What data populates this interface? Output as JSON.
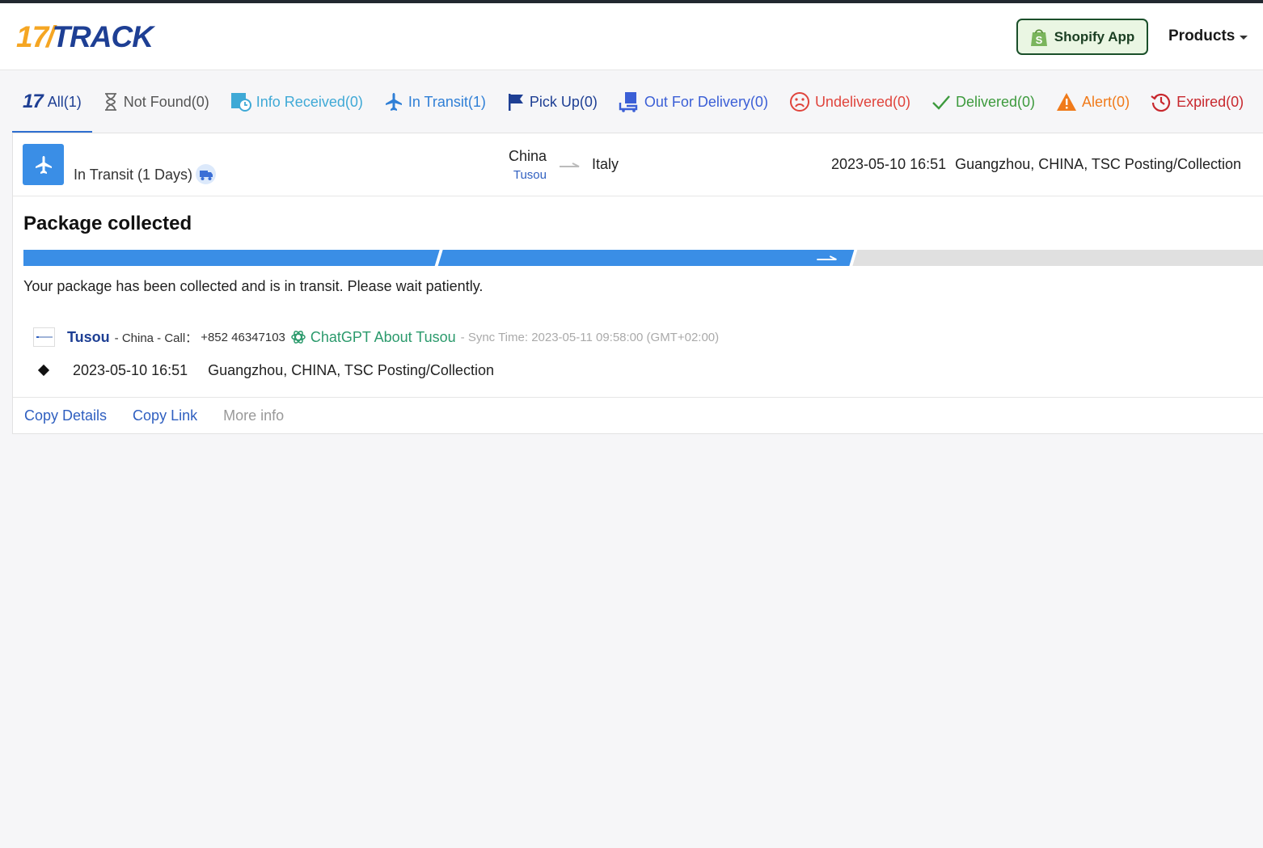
{
  "brand": {
    "logo_num": "17",
    "logo_word": "TRACK"
  },
  "header": {
    "shopify_label": "Shopify App",
    "products_label": "Products"
  },
  "colors": {
    "accent": "#3a8ee6",
    "brand_blue": "#1e3f94",
    "brand_orange": "#f5a623"
  },
  "tabs": [
    {
      "label": "All(1)",
      "icon": "seventeen-logo-icon",
      "color": "#1e3f94"
    },
    {
      "label": "Not Found(0)",
      "icon": "hourglass-icon",
      "color": "#555555"
    },
    {
      "label": "Info Received(0)",
      "icon": "info-received-icon",
      "color": "#3fa9d6"
    },
    {
      "label": "In Transit(1)",
      "icon": "plane-icon",
      "color": "#2f7fd6"
    },
    {
      "label": "Pick Up(0)",
      "icon": "flag-icon",
      "color": "#1e3f94"
    },
    {
      "label": "Out For Delivery(0)",
      "icon": "out-for-delivery-icon",
      "color": "#3b5fd6"
    },
    {
      "label": "Undelivered(0)",
      "icon": "sad-face-icon",
      "color": "#e0443c"
    },
    {
      "label": "Delivered(0)",
      "icon": "check-icon",
      "color": "#3d9a3d"
    },
    {
      "label": "Alert(0)",
      "icon": "warning-icon",
      "color": "#f07a1a"
    },
    {
      "label": "Expired(0)",
      "icon": "history-icon",
      "color": "#c8282e"
    }
  ],
  "shipment": {
    "status": "In Transit (1 Days)",
    "origin_country": "China",
    "origin_carrier": "Tusou",
    "dest_country": "Italy",
    "latest_time": "2023-05-10 16:51",
    "latest_place": "Guangzhou, CHINA, TSC Posting/Collection"
  },
  "detail": {
    "title": "Package collected",
    "progress_fraction": 0.67,
    "description": "Your package has been collected and is in transit. Please wait patiently.",
    "carrier_name": "Tusou",
    "carrier_country": "- China - Call：",
    "carrier_phone": "+852 46347103",
    "chatgpt_label": "ChatGPT About Tusou",
    "sync_time": "- Sync Time: 2023-05-11 09:58:00 (GMT+02:00)"
  },
  "events": [
    {
      "time": "2023-05-10 16:51",
      "place": "Guangzhou, CHINA, TSC Posting/Collection"
    }
  ],
  "actions": {
    "copy_details": "Copy Details",
    "copy_link": "Copy Link",
    "more_info": "More info"
  }
}
